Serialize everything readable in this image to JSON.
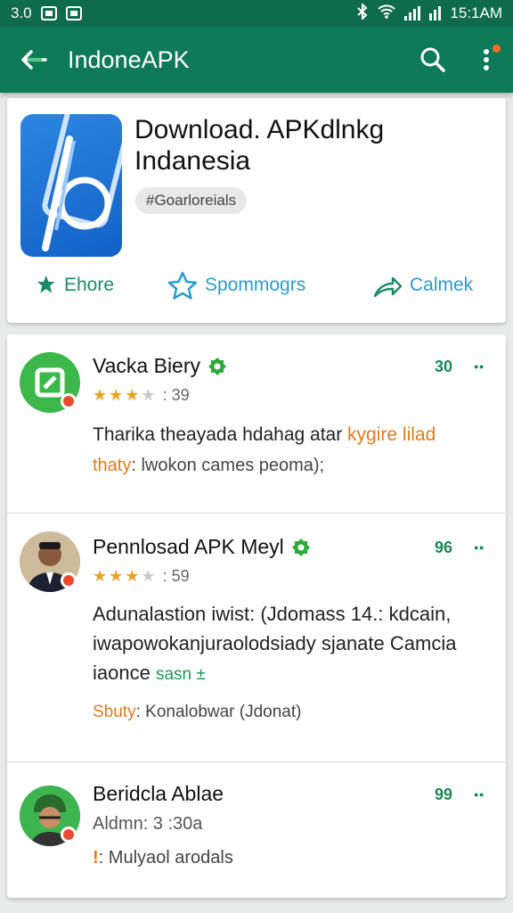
{
  "status_bar": {
    "time_left": "3.0",
    "time_right": "15:1AM"
  },
  "app_bar": {
    "title": "IndoneAPK",
    "back_icon": "back-arrow-icon",
    "search_icon": "search-icon",
    "more_icon": "more-vert-icon"
  },
  "hero": {
    "title": "Download. APKdlnkg Indanesia",
    "chip": "#Goarloreials",
    "actions": [
      {
        "label": "Ehore",
        "icon": "pin-icon"
      },
      {
        "label": "Spommogrs",
        "icon": "star-outline-icon"
      },
      {
        "label": "Calmek",
        "icon": "share-icon"
      }
    ]
  },
  "items": [
    {
      "title": "Vacka Biery",
      "count": "30",
      "more": "••",
      "rating_stars": 3,
      "rating_text": ": 39",
      "desc_plain": "Tharika theayada hdahag atar ",
      "desc_orange": "kygire lilad",
      "meta_orange": "thaty",
      "meta": ": lwokon cames peoma);"
    },
    {
      "title": "Pennlosad APK Meyl",
      "count": "96",
      "more": "••",
      "rating_stars": 3,
      "rating_text": ": 59",
      "desc_line1": "Adunalastion iwist: (Jdomass 14.: kdcain,",
      "desc_line2": "iwapowokanjuraolodsiady sjanate Camcia",
      "desc_line3_plain": "iaonce ",
      "desc_line3_green": "sasn ±",
      "meta_orange": "Sbuty",
      "meta": ": Konalobwar (Jdonat)"
    },
    {
      "title": "Beridcla Ablae",
      "count": "99",
      "more": "••",
      "subtitle": "Aldmn: 3 :30a",
      "meta_icon_text": "!",
      "meta": ": Mulyaol arodals"
    }
  ],
  "colors": {
    "primary": "#0f7a57",
    "accent_orange": "#e07a1a",
    "star": "#f0a11c"
  }
}
